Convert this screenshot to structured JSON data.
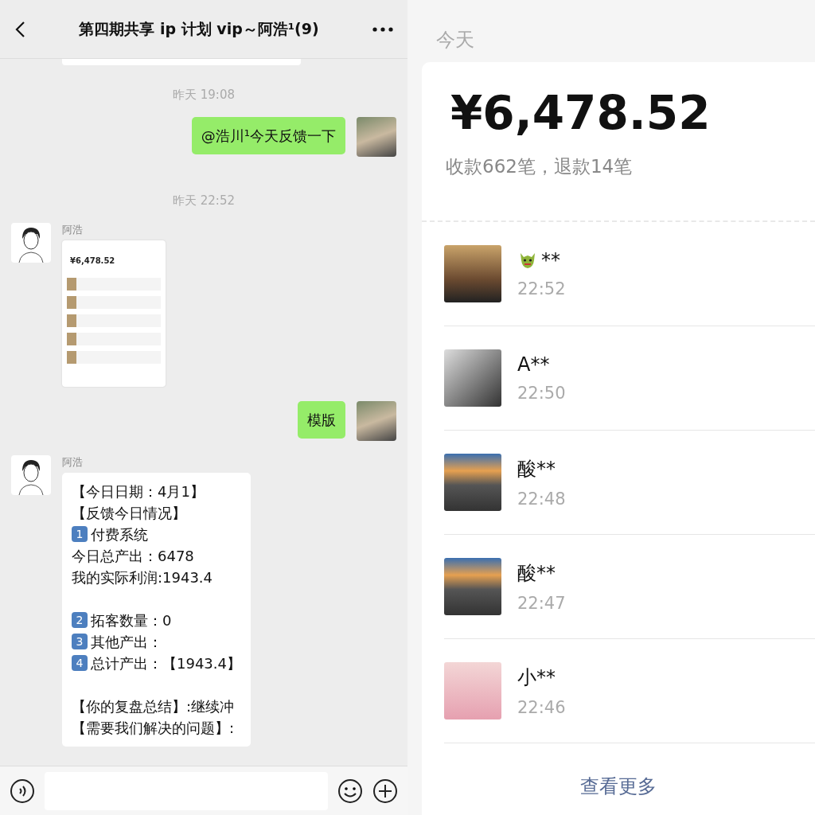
{
  "chat": {
    "title": "第四期共享 ip 计划 vip～阿浩¹(9)",
    "messages": [
      {
        "kind": "time",
        "text": "昨天 19:08"
      },
      {
        "kind": "text",
        "outgoing": true,
        "lines": [
          {
            "text": "@浩川¹今天反馈一下",
            "gap_before": false
          }
        ]
      },
      {
        "kind": "time",
        "text": "昨天 22:52"
      },
      {
        "kind": "image",
        "outgoing": false,
        "sender": "阿浩",
        "amount": "¥6,478.52"
      },
      {
        "kind": "text",
        "outgoing": true,
        "lines": [
          {
            "text": "模版",
            "gap_before": false
          }
        ]
      },
      {
        "kind": "text",
        "outgoing": false,
        "sender": "阿浩",
        "lines": [
          {
            "text": "【今日日期：4月1】",
            "gap_before": false
          },
          {
            "text": "【反馈今日情况】",
            "gap_before": false
          },
          {
            "badge": "1",
            "text": "付费系统",
            "gap_before": false
          },
          {
            "text": "今日总产出：6478",
            "gap_before": false
          },
          {
            "text": "我的实际利润:1943.4",
            "gap_before": false
          },
          {
            "badge": "2",
            "text": "拓客数量：0",
            "gap_before": true
          },
          {
            "badge": "3",
            "text": "其他产出：",
            "gap_before": false
          },
          {
            "badge": "4",
            "text": "总计产出：【1943.4】",
            "gap_before": false
          },
          {
            "text": "【你的复盘总结】:继续冲",
            "gap_before": true
          },
          {
            "text": "【需要我们解决的问题】:",
            "gap_before": false
          }
        ]
      }
    ]
  },
  "receipts": {
    "day": "今天",
    "total": "¥6,478.52",
    "summary": "收款662笔，退款14笔",
    "payments": [
      {
        "name": "**",
        "dragon": true,
        "time": "22:52"
      },
      {
        "name": "A**",
        "dragon": false,
        "time": "22:50"
      },
      {
        "name": "酸**",
        "dragon": false,
        "time": "22:48"
      },
      {
        "name": "酸**",
        "dragon": false,
        "time": "22:47"
      },
      {
        "name": "小**",
        "dragon": false,
        "time": "22:46"
      }
    ],
    "more": "查看更多"
  }
}
